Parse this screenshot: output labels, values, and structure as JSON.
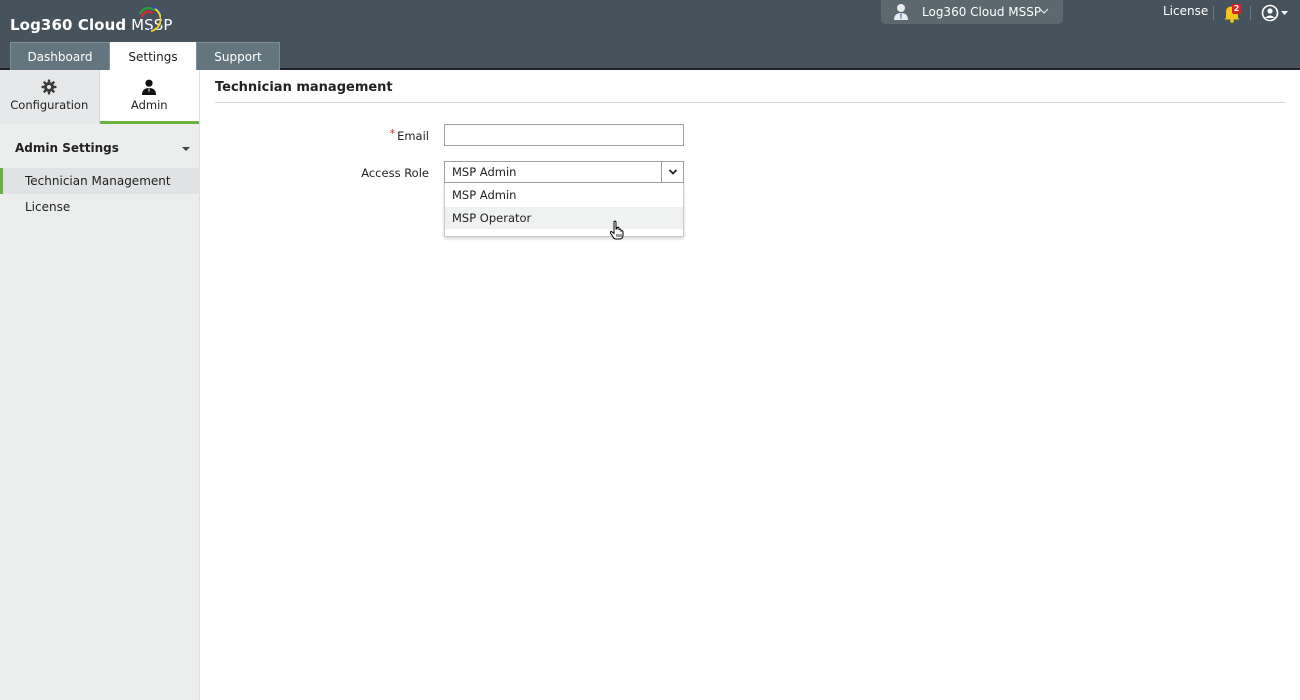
{
  "header": {
    "app_name_bold": "Log360 Cloud",
    "app_name_light": " MSSP",
    "tabs": [
      {
        "label": "Dashboard",
        "active": false
      },
      {
        "label": "Settings",
        "active": true
      },
      {
        "label": "Support",
        "active": false
      }
    ],
    "org_switcher": {
      "label": "Log360 Cloud MSSP",
      "icon": "user-icon"
    },
    "license_link": "License",
    "notifications": {
      "icon": "bell-icon",
      "count": "2",
      "color": "#f5c518",
      "badge_color": "#e02020"
    },
    "profile_icon": "user-circle-icon"
  },
  "sidebar": {
    "subtabs": [
      {
        "label": "Configuration",
        "icon": "gear-icon",
        "active": false
      },
      {
        "label": "Admin",
        "icon": "admin-user-icon",
        "active": true
      }
    ],
    "section_title": "Admin Settings",
    "items": [
      {
        "label": "Technician Management",
        "active": true
      },
      {
        "label": "License",
        "active": false
      }
    ],
    "accent_color": "#6bb33f"
  },
  "main": {
    "title": "Technician management",
    "form": {
      "email": {
        "label": "Email",
        "required_mark": "*",
        "value": "",
        "placeholder": ""
      },
      "access_role": {
        "label": "Access Role",
        "selected": "MSP Admin",
        "options": [
          "MSP Admin",
          "MSP Operator"
        ],
        "hovered_option": "MSP Operator",
        "open": true
      }
    }
  }
}
